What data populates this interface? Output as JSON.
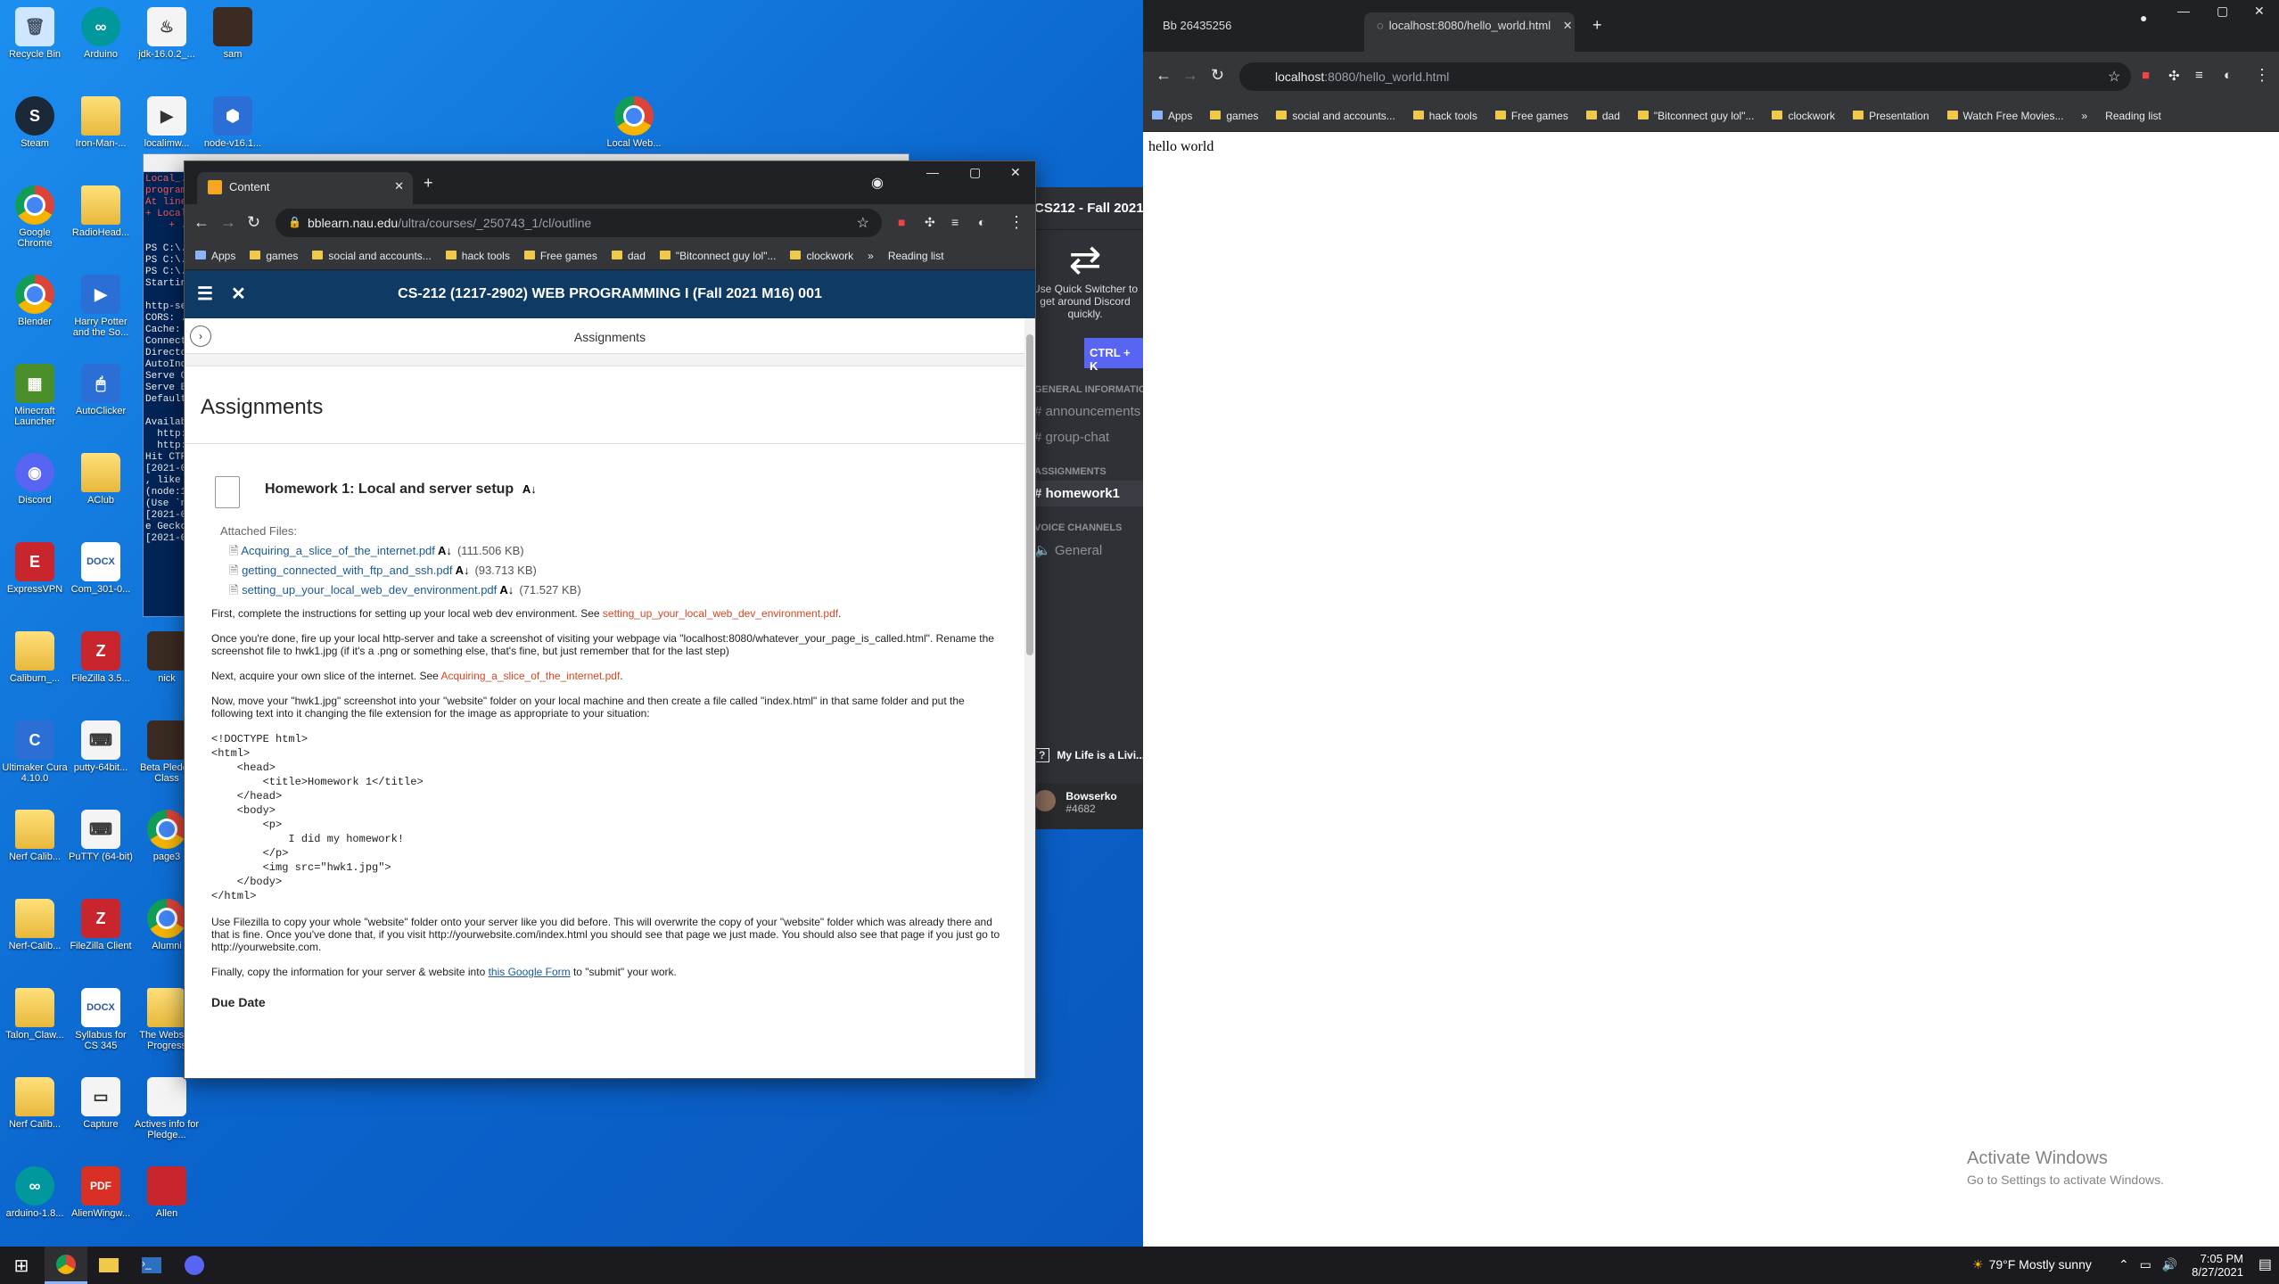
{
  "desktop": {
    "icons": [
      {
        "label": "Recycle Bin",
        "glyph": "🗑",
        "kind": "bin",
        "col": 0,
        "row": 0
      },
      {
        "label": "Arduino",
        "glyph": "∞",
        "kind": "teal",
        "col": 1,
        "row": 0
      },
      {
        "label": "jdk-16.0.2_...",
        "glyph": "♨",
        "kind": "white",
        "col": 2,
        "row": 0
      },
      {
        "label": "sam",
        "glyph": "",
        "kind": "dark",
        "col": 3,
        "row": 0
      },
      {
        "label": "Steam",
        "glyph": "S",
        "kind": "steam",
        "col": 0,
        "row": 1
      },
      {
        "label": "Iron-Man-...",
        "glyph": "",
        "kind": "folder",
        "col": 1,
        "row": 1
      },
      {
        "label": "localimw...",
        "glyph": "▶",
        "kind": "white",
        "col": 2,
        "row": 1
      },
      {
        "label": "node-v16.1...",
        "glyph": "⬢",
        "kind": "blue",
        "col": 3,
        "row": 1
      },
      {
        "label": "Google Chrome",
        "glyph": "",
        "kind": "chrome",
        "col": 0,
        "row": 2
      },
      {
        "label": "RadioHead...",
        "glyph": "",
        "kind": "folder",
        "col": 1,
        "row": 2
      },
      {
        "label": "Blender",
        "glyph": "",
        "kind": "chrome",
        "col": 0,
        "row": 3
      },
      {
        "label": "Harry Potter and the So...",
        "glyph": "▶",
        "kind": "blue",
        "col": 1,
        "row": 3
      },
      {
        "label": "Minecraft Launcher",
        "glyph": "▦",
        "kind": "green",
        "col": 0,
        "row": 4
      },
      {
        "label": "AutoClicker",
        "glyph": "🖱",
        "kind": "blue",
        "col": 1,
        "row": 4
      },
      {
        "label": "Discord",
        "glyph": "◉",
        "kind": "discord",
        "col": 0,
        "row": 5
      },
      {
        "label": "AClub",
        "glyph": "",
        "kind": "folder",
        "col": 1,
        "row": 5
      },
      {
        "label": "ExpressVPN",
        "glyph": "E",
        "kind": "red",
        "col": 0,
        "row": 6
      },
      {
        "label": "Com_301-0...",
        "glyph": "DOCX",
        "kind": "doc",
        "col": 1,
        "row": 6
      },
      {
        "label": "Caliburn_...",
        "glyph": "",
        "kind": "folder",
        "col": 0,
        "row": 7
      },
      {
        "label": "FileZilla 3.5...",
        "glyph": "Z",
        "kind": "red",
        "col": 1,
        "row": 7
      },
      {
        "label": "nick",
        "glyph": "",
        "kind": "dark",
        "col": 2,
        "row": 7
      },
      {
        "label": "Ultimaker Cura 4.10.0",
        "glyph": "C",
        "kind": "blue",
        "col": 0,
        "row": 8
      },
      {
        "label": "putty-64bit...",
        "glyph": "⌨",
        "kind": "white",
        "col": 1,
        "row": 8
      },
      {
        "label": "Beta Pledge Class",
        "glyph": "",
        "kind": "dark",
        "col": 2,
        "row": 8
      },
      {
        "label": "Nerf Calib...",
        "glyph": "",
        "kind": "folder",
        "col": 0,
        "row": 9
      },
      {
        "label": "PuTTY (64-bit)",
        "glyph": "⌨",
        "kind": "white",
        "col": 1,
        "row": 9
      },
      {
        "label": "page3",
        "glyph": "",
        "kind": "chrome",
        "col": 2,
        "row": 9
      },
      {
        "label": "Nerf-Calib...",
        "glyph": "",
        "kind": "folder",
        "col": 0,
        "row": 10
      },
      {
        "label": "FileZilla Client",
        "glyph": "Z",
        "kind": "red",
        "col": 1,
        "row": 10
      },
      {
        "label": "Alumni",
        "glyph": "",
        "kind": "chrome",
        "col": 2,
        "row": 10
      },
      {
        "label": "Talon_Claw...",
        "glyph": "",
        "kind": "folder",
        "col": 0,
        "row": 11
      },
      {
        "label": "Syllabus for CS 345",
        "glyph": "DOCX",
        "kind": "doc",
        "col": 1,
        "row": 11
      },
      {
        "label": "The Webs in Progress",
        "glyph": "",
        "kind": "folder",
        "col": 2,
        "row": 11
      },
      {
        "label": "Nerf Calib...",
        "glyph": "",
        "kind": "folder",
        "col": 0,
        "row": 12
      },
      {
        "label": "Capture",
        "glyph": "▭",
        "kind": "white",
        "col": 1,
        "row": 12
      },
      {
        "label": "Actives info for Pledge...",
        "glyph": "",
        "kind": "white",
        "col": 2,
        "row": 12
      },
      {
        "label": "arduino-1.8...",
        "glyph": "∞",
        "kind": "teal",
        "col": 0,
        "row": 13
      },
      {
        "label": "AlienWingw...",
        "glyph": "PDF",
        "kind": "pdf",
        "col": 1,
        "row": 13
      },
      {
        "label": "Allen",
        "glyph": "",
        "kind": "red",
        "col": 2,
        "row": 13
      },
      {
        "label": "Local Web...",
        "glyph": "",
        "kind": "chrome",
        "col": 9,
        "row": 1
      }
    ]
  },
  "powershell": {
    "lines": [
      "Local_...",
      "program...",
      "At line...",
      "+ Local...",
      "    + ...",
      "",
      "PS C:\\...",
      "PS C:\\...",
      "PS C:\\...",
      "Startin...",
      "",
      "http-se...",
      "CORS: ...",
      "Cache: ...",
      "Connect...",
      "Directo...",
      "AutoInd...",
      "Serve G...",
      "Serve B...",
      "Default...",
      "",
      "Availab...",
      "  http:...",
      "  http:...",
      "Hit CTR...",
      "[2021-0...",
      ", like ...",
      "(node:1...",
      "(Use `n...",
      "[2021-0...",
      "e Gecko...",
      "[2021-0..."
    ],
    "error_lines": 5
  },
  "discord": {
    "server_name": "CS212 - Fall 2021",
    "quick_switcher_text": "Use Quick Switcher to get around Discord quickly.",
    "quick_switcher_button": "CTRL + K",
    "categories": [
      {
        "name": "GENERAL INFORMATION",
        "channels": [
          {
            "name": "announcements",
            "active": false
          },
          {
            "name": "group-chat",
            "active": false
          }
        ]
      },
      {
        "name": "ASSIGNMENTS",
        "channels": [
          {
            "name": "homework1",
            "active": true
          }
        ]
      },
      {
        "name": "VOICE CHANNELS",
        "channels": [
          {
            "name": "General",
            "active": false
          }
        ]
      }
    ],
    "activity": "My Life is a Livi...",
    "username": "Bowserko",
    "discriminator": "#4682"
  },
  "right_browser": {
    "tabs": [
      {
        "label": "Bb  26435256",
        "active": false
      },
      {
        "label": "localhost:8080/hello_world.html",
        "active": true
      }
    ],
    "url_host": "localhost",
    "url_rest": ":8080/hello_world.html",
    "bookmarks": [
      "Apps",
      "games",
      "social and accounts...",
      "hack tools",
      "Free games",
      "dad",
      "\"Bitconnect guy lol\"...",
      "clockwork",
      "Presentation",
      "Watch Free Movies..."
    ],
    "reading_list": "Reading list",
    "page_text": "hello world"
  },
  "front_browser": {
    "tab_label": "Content",
    "url_host": "bblearn.nau.edu",
    "url_rest": "/ultra/courses/_250743_1/cl/outline",
    "bookmarks": [
      "Apps",
      "games",
      "social and accounts...",
      "hack tools",
      "Free games",
      "dad",
      "\"Bitconnect guy lol\"...",
      "clockwork"
    ],
    "reading_list": "Reading list",
    "course_title": "CS-212 (1217-2902) WEB PROGRAMMING I (Fall 2021 M16) 001",
    "breadcrumb": "Assignments",
    "heading": "Assignments",
    "homework_title": "Homework 1: Local and server setup",
    "attached_label": "Attached Files:",
    "files": [
      {
        "name": "Acquiring_a_slice_of_the_internet.pdf",
        "size": "(111.506 KB)"
      },
      {
        "name": "getting_connected_with_ftp_and_ssh.pdf",
        "size": "(93.713 KB)"
      },
      {
        "name": "setting_up_your_local_web_dev_environment.pdf",
        "size": "(71.527 KB)"
      }
    ],
    "p1_text": "First, complete the instructions for setting up your local web dev environment. See ",
    "p1_link": "setting_up_your_local_web_dev_environment.pdf",
    "p1_end": ".",
    "p2": "Once you're done, fire up your local http-server and take a screenshot of visiting your webpage via \"localhost:8080/whatever_your_page_is_called.html\".  Rename the screenshot file to hwk1.jpg (if it's a .png or something else, that's fine, but just remember that for the last step)",
    "p3_text": "Next, acquire your own slice of the internet. See ",
    "p3_link": "Acquiring_a_slice_of_the_internet.pdf",
    "p3_end": ".",
    "p4": "Now, move your \"hwk1.jpg\" screenshot into your \"website\" folder on your local machine and then create a file called \"index.html\" in that same folder and put the following text into it changing the file extension for the image as appropriate to your situation:",
    "code": "<!DOCTYPE html>\n<html>\n    <head>\n        <title>Homework 1</title>\n    </head>\n    <body>\n        <p>\n            I did my homework!\n        </p>\n        <img src=\"hwk1.jpg\">\n    </body>\n</html>",
    "p5": "Use Filezilla to copy your whole \"website\" folder onto your server like you did before.  This will overwrite the copy of your \"website\" folder which was already there and that is fine.  Once you've done that, if you visit http://yourwebsite.com/index.html you should see that page we just made.  You should also see that page if you just go to http://yourwebsite.com.",
    "p6_text": "Finally, copy the information for your server & website into ",
    "p6_link": "this Google Form",
    "p6_end": " to \"submit\" your work.",
    "due_date": "Due Date"
  },
  "activate": {
    "line1": "Activate Windows",
    "line2": "Go to Settings to activate Windows."
  },
  "taskbar": {
    "weather": "79°F  Mostly sunny",
    "time": "7:05 PM",
    "date": "8/27/2021"
  }
}
